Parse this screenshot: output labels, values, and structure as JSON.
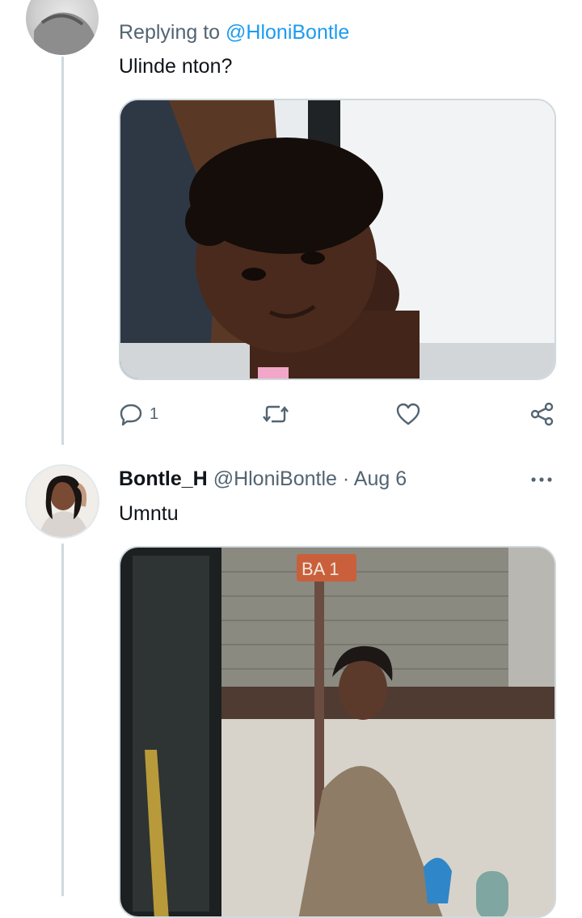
{
  "reply_tweet": {
    "replying_prefix": "Replying to",
    "replying_handle": "@HloniBontle",
    "text": "Ulinde nton?",
    "media_alt": "Photo of a smiling toddler",
    "actions": {
      "reply_count": "1",
      "retweet_count": "",
      "like_count": ""
    }
  },
  "main_tweet": {
    "display_name": "Bontle_H",
    "handle": "@HloniBontle",
    "separator": "·",
    "date": "Aug 6",
    "text": "Umntu",
    "media_alt": "Photo of a woman near a bus stop sign",
    "sign_text": "BA  1"
  },
  "icons": {
    "reply": "reply-icon",
    "retweet": "retweet-icon",
    "like": "like-icon",
    "share": "share-icon",
    "more": "more-icon"
  },
  "colors": {
    "accent": "#1d9bf0",
    "muted": "#536471",
    "thread_line": "#cfd9de"
  }
}
